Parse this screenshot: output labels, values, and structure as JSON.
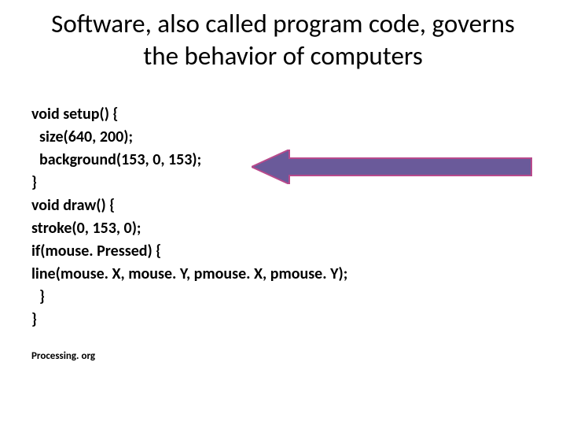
{
  "title": "Software, also called program code, governs the behavior of computers",
  "code": {
    "line1": "void setup() {",
    "line2": "size(640, 200);",
    "line3": "background(153, 0, 153);",
    "line4": "}",
    "line5": "void draw() {",
    "line6": "stroke(0, 153, 0);",
    "line7": "if(mouse. Pressed) {",
    "line8": "line(mouse. X, mouse. Y, pmouse. X, pmouse. Y);",
    "line9": "}",
    "line10": "}"
  },
  "source": "Processing. org",
  "arrow": {
    "fill": "#6a5a9a",
    "stroke": "#b84a8c"
  }
}
